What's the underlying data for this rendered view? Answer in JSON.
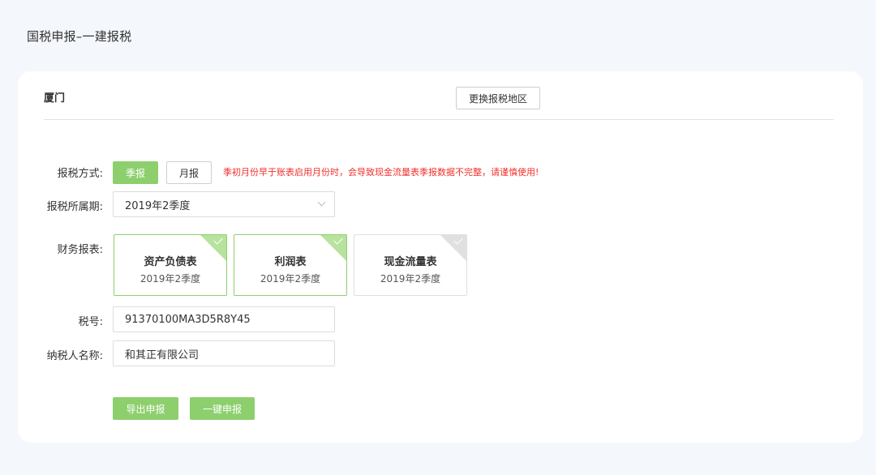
{
  "page": {
    "title": "国税申报–一建报税"
  },
  "header": {
    "region": "厦门",
    "change_region_label": "更换报税地区"
  },
  "form": {
    "method_label": "报税方式:",
    "method_options": [
      "季报",
      "月报"
    ],
    "method_selected": "季报",
    "warning": "季初月份早于账表启用月份时，会导致现金流量表季报数据不完整，请谨慎使用!",
    "period_label": "报税所属期:",
    "period_value": "2019年2季度",
    "reports_label": "财务报表:",
    "reports": [
      {
        "title": "资产负债表",
        "period": "2019年2季度",
        "selected": true
      },
      {
        "title": "利润表",
        "period": "2019年2季度",
        "selected": true
      },
      {
        "title": "现金流量表",
        "period": "2019年2季度",
        "selected": false
      }
    ],
    "tax_no_label": "税号:",
    "tax_no_value": "91370100MA3D5R8Y45",
    "taxpayer_label": "纳税人名称:",
    "taxpayer_value": "和其正有限公司"
  },
  "actions": {
    "export_label": "导出申报",
    "one_click_label": "一键申报"
  },
  "colors": {
    "accent": "#8dcf6d",
    "warning": "#f0302d",
    "background": "#f4f7fb"
  },
  "icons": {
    "check": "checkmark-icon",
    "dropdown": "chevron-down-icon"
  }
}
